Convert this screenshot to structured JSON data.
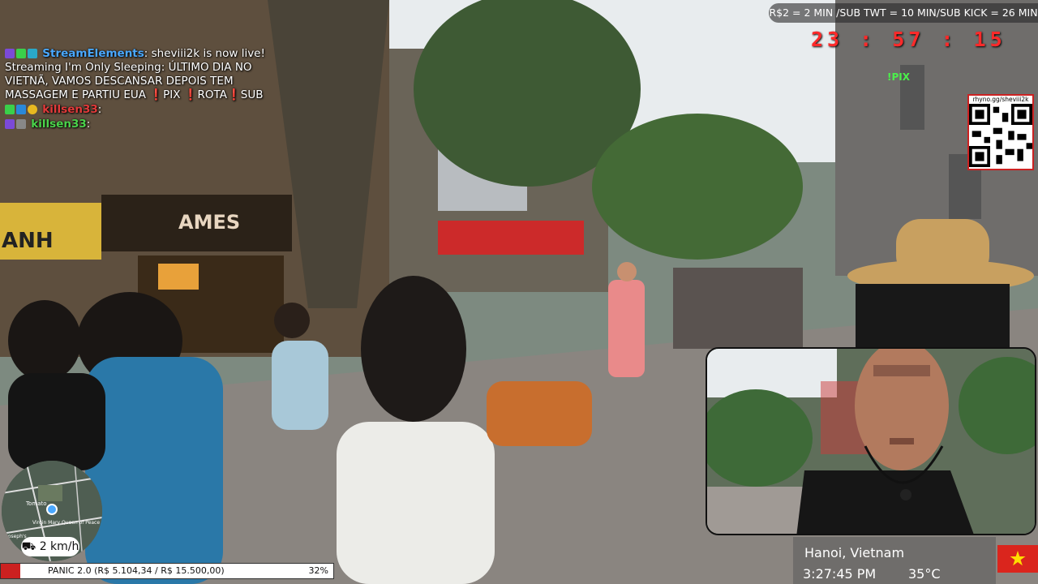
{
  "chat": {
    "line1_user": "StreamElements",
    "line1_text": ": sheviii2k is now live! Streaming I'm Only Sleeping: ÚLTIMO DIA NO VIETNÃ, VAMOS DESCANSAR DEPOIS TEM MASSAGEM E PARTIU EUA ❗PIX ❗ROTA❗SUB",
    "line2_user": "killsen33",
    "line2_text": ": ",
    "line3_user": "killsen33",
    "line3_text": ":"
  },
  "alerts": {
    "text": "R$2 = 2 MIN /SUB TWT = 10 MIN/SUB KICK = 26 MIN"
  },
  "timer": {
    "text": "23 : 57 : 15"
  },
  "pix": {
    "label": "!PIX"
  },
  "qr": {
    "url": "rhyno.gg/sheviii2k"
  },
  "location": {
    "city": "Hanoi, Vietnam",
    "time": "3:27:45 PM",
    "temp": "35°C"
  },
  "speed": {
    "value": "2 km/h"
  },
  "map_labels": [
    "Tomato",
    "Virgin Mary Queen of Peace",
    "Joseph's"
  ],
  "goal": {
    "text": "PANIC 2.0 (R$ 5.104,34 / R$ 15.500,00)",
    "percent": 32,
    "percent_text": "32%"
  },
  "colors": {
    "timer": "#ff2a2a",
    "pix": "#4bf04b",
    "goal_fill": "#cc2020",
    "chat_user": "#4aa8ff",
    "chat_user2": "#4bd34b"
  }
}
